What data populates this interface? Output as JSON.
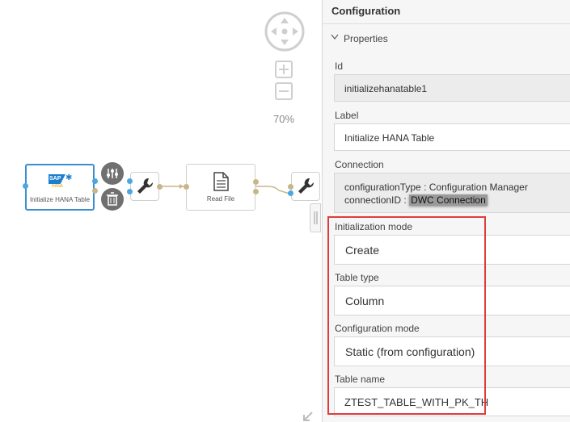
{
  "canvas": {
    "zoom_level": "70%",
    "nodes": [
      {
        "id": "initialize-hana-table",
        "label": "Initialize HANA Table",
        "logo_text": "SAP",
        "logo_subtext": "HANA"
      },
      {
        "id": "read-file",
        "label": "Read File"
      }
    ],
    "colors": {
      "accent": "#3b8fd1",
      "port_blue": "#4aa8e0",
      "port_tan": "#c9b58a"
    }
  },
  "panel": {
    "title": "Configuration",
    "section": "Properties",
    "fields": {
      "id": {
        "label": "Id",
        "value": "initializehanatable1"
      },
      "label": {
        "label": "Label",
        "value": "Initialize HANA Table"
      },
      "connection": {
        "label": "Connection",
        "line1_key": "configurationType",
        "line1_value": "Configuration Manager",
        "line2_key": "connectionID",
        "line2_value": "DWC Connection"
      },
      "init_mode": {
        "label": "Initialization mode",
        "value": "Create"
      },
      "table_type": {
        "label": "Table type",
        "value": "Column"
      },
      "config_mode": {
        "label": "Configuration mode",
        "value": "Static (from configuration)"
      },
      "table_name": {
        "label": "Table name",
        "value": "ZTEST_TABLE_WITH_PK_TH"
      }
    },
    "colors": {
      "highlight": "#e03b3b"
    }
  }
}
